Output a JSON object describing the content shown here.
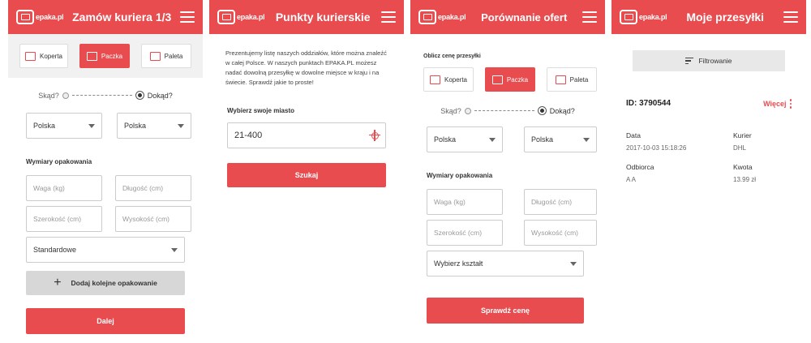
{
  "logo_text": "epaka.pl",
  "screen1": {
    "title": "Zamów kuriera 1/3",
    "types": [
      {
        "label": "Koperta",
        "icon": "envelope-icon",
        "active": false
      },
      {
        "label": "Paczka",
        "icon": "box-icon",
        "active": true
      },
      {
        "label": "Paleta",
        "icon": "pallet-icon",
        "active": false
      }
    ],
    "from_label": "Skąd?",
    "to_label": "Dokąd?",
    "from_country": "Polska",
    "to_country": "Polska",
    "dimensions_heading": "Wymiary opakowania",
    "weight_placeholder": "Waga (kg)",
    "length_placeholder": "Długość (cm)",
    "width_placeholder": "Szerokość (cm)",
    "height_placeholder": "Wysokość (cm)",
    "shape_value": "Standardowe",
    "add_package_label": "Dodaj kolejne opakowanie",
    "next_label": "Dalej"
  },
  "screen2": {
    "title": "Punkty kurierskie",
    "intro": "Prezentujemy listę naszych oddziałów, które można znaleźć w całej Polsce. W naszych punktach EPAKA.PL możesz nadać dowolną przesyłkę w dowolne miejsce w kraju i na świecie. Sprawdź jakie to proste!",
    "city_label": "Wybierz swoje miasto",
    "city_value": "21-400",
    "search_label": "Szukaj"
  },
  "screen3": {
    "title": "Porównanie ofert",
    "price_heading": "Oblicz cenę przesyłki",
    "types": [
      {
        "label": "Koperta",
        "icon": "envelope-icon",
        "active": false
      },
      {
        "label": "Paczka",
        "icon": "box-icon",
        "active": true
      },
      {
        "label": "Paleta",
        "icon": "pallet-icon",
        "active": false
      }
    ],
    "from_label": "Skąd?",
    "to_label": "Dokąd?",
    "from_country": "Polska",
    "to_country": "Polska",
    "dimensions_heading": "Wymiary opakowania",
    "weight_placeholder": "Waga (kg)",
    "length_placeholder": "Długość (cm)",
    "width_placeholder": "Szerokość (cm)",
    "height_placeholder": "Wysokość (cm)",
    "shape_placeholder": "Wybierz kształt",
    "check_price_label": "Sprawdź cenę"
  },
  "screen4": {
    "title": "Moje przesyłki",
    "filter_label": "Filtrowanie",
    "package_id": "ID: 3790544",
    "more_label": "Więcej",
    "date_label": "Data",
    "date_value": "2017-10-03 15:18:26",
    "courier_label": "Kurier",
    "courier_value": "DHL",
    "recipient_label": "Odbiorca",
    "recipient_value": "A A",
    "amount_label": "Kwota",
    "amount_value": "13.99 zł"
  },
  "colors": {
    "accent": "#e84c4f",
    "button_gray": "#d7d7d7",
    "panel_gray": "#f1f1f1"
  }
}
